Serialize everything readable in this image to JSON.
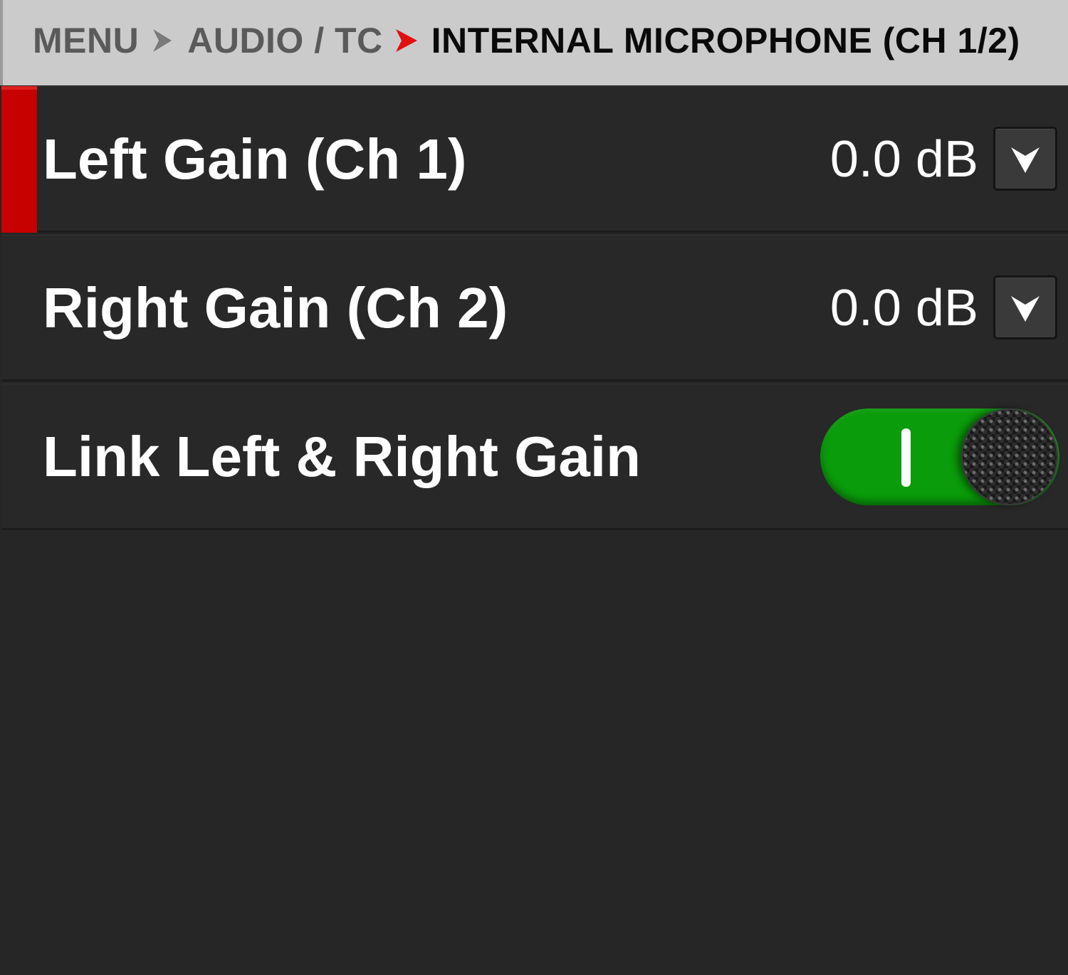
{
  "breadcrumb": {
    "items": [
      "MENU",
      "AUDIO / TC"
    ],
    "current": "INTERNAL MICROPHONE (CH 1/2)"
  },
  "colors": {
    "header_bg": "#cbcbcb",
    "accent_red": "#c70000",
    "toggle_on_green": "#0a9c0a",
    "panel_bg": "#262626"
  },
  "settings": {
    "left_gain": {
      "label": "Left Gain (Ch 1)",
      "value": "0.0 dB",
      "selected": true,
      "control_icon": "chevron-down-icon"
    },
    "right_gain": {
      "label": "Right Gain (Ch 2)",
      "value": "0.0 dB",
      "selected": false,
      "control_icon": "chevron-down-icon"
    },
    "link_gain": {
      "label": "Link Left & Right Gain",
      "state": "on"
    }
  }
}
